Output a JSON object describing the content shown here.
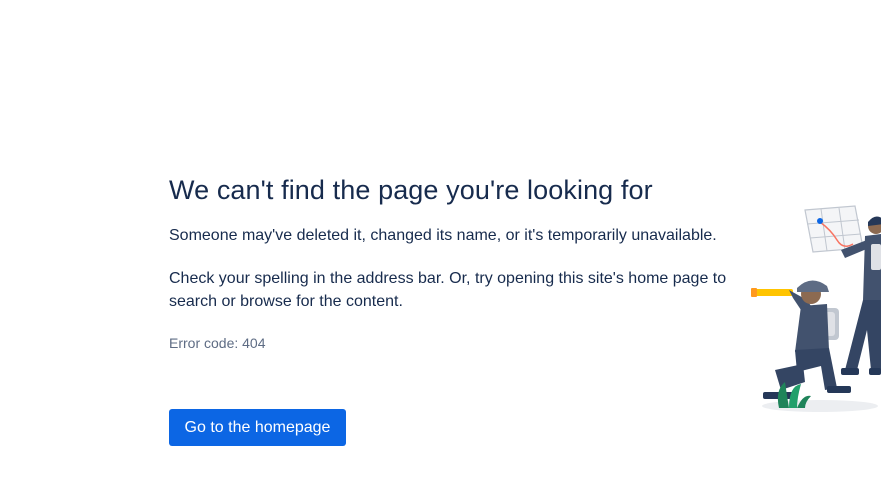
{
  "error_page": {
    "title": "We can't find the page you're looking for",
    "message_1": "Someone may've deleted it, changed its name, or it's temporarily unavailable.",
    "message_2": "Check your spelling in the address bar. Or, try opening this site's home page to search or browse for the content.",
    "error_code": "Error code: 404",
    "button_label": "Go to the homepage"
  },
  "colors": {
    "heading": "#172b4d",
    "secondary_text": "#5e6c84",
    "button_bg": "#0c66e4",
    "button_text": "#ffffff"
  },
  "illustration": {
    "name": "explorers-with-map-and-spyglass"
  }
}
